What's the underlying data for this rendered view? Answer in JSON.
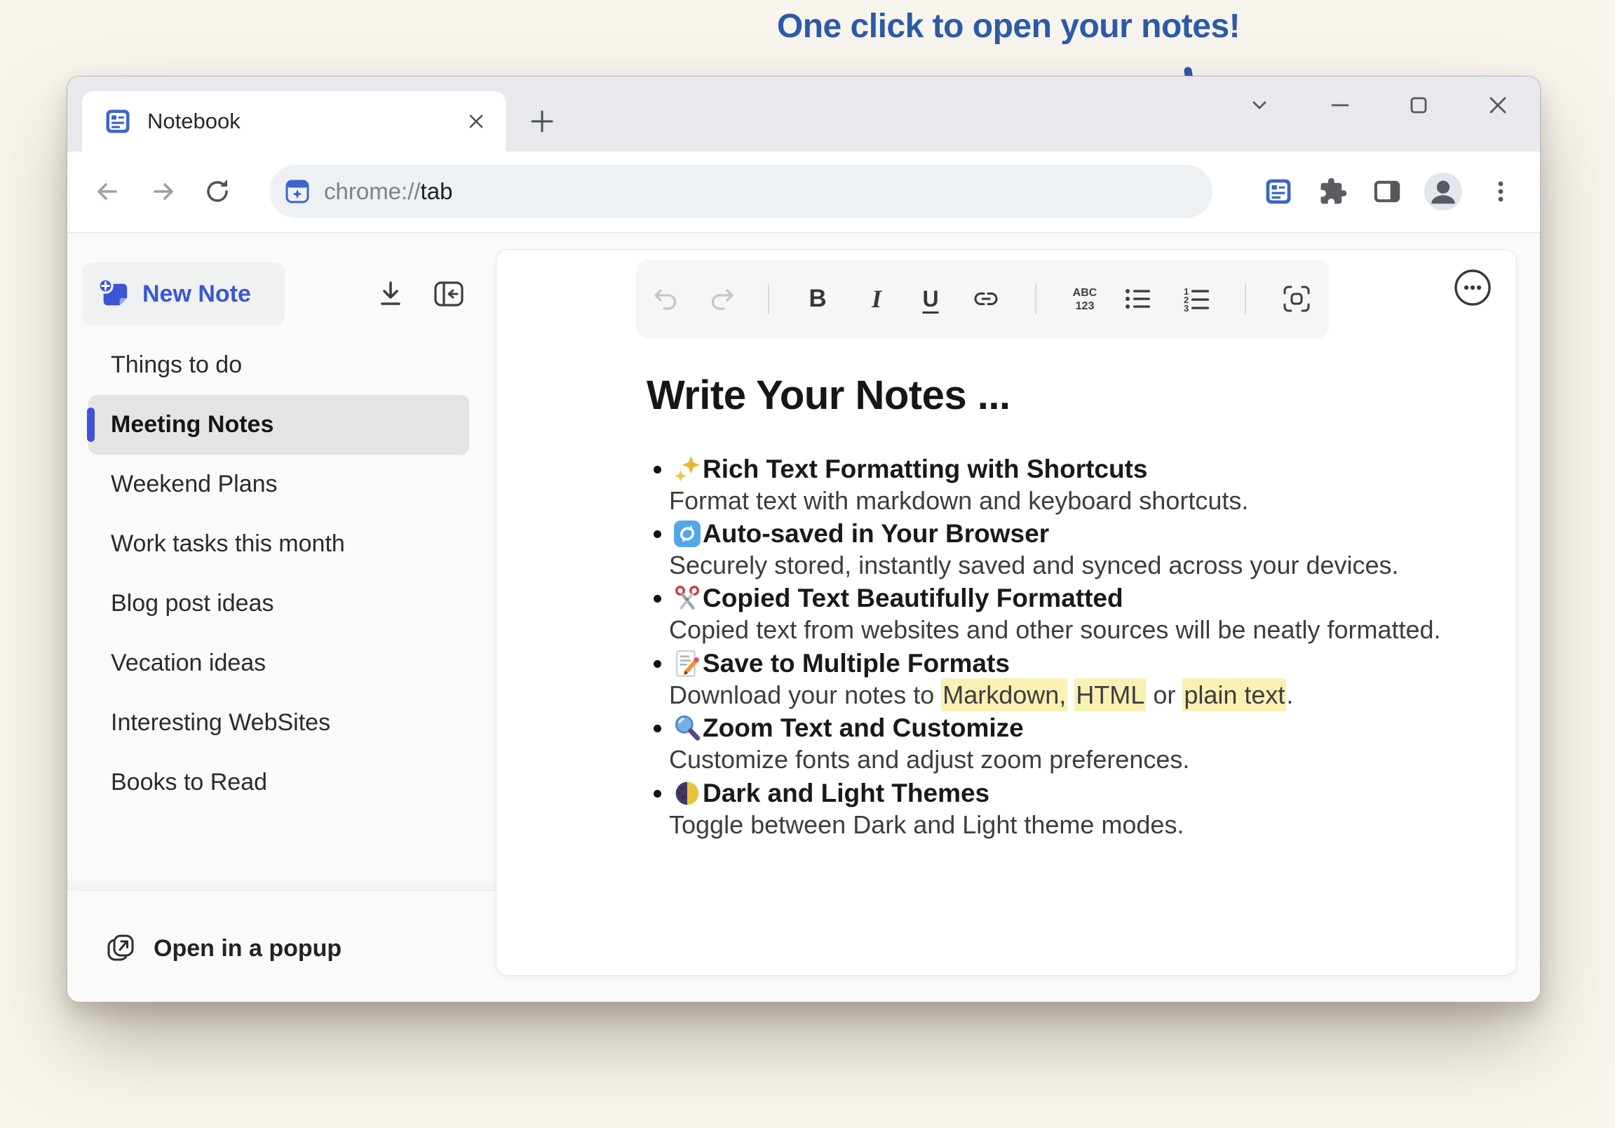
{
  "annotation": {
    "headline": "One click to open your notes!",
    "arrow_color": "#2b57a8"
  },
  "browser": {
    "tab": {
      "title": "Notebook",
      "favicon": "notebook-icon"
    },
    "window_controls": [
      "restore-down",
      "minimize",
      "maximize",
      "close"
    ],
    "address": {
      "protocol": "chrome://",
      "path": "tab",
      "site_icon": "notebook-sparkle-icon"
    },
    "toolbar_icons": [
      "notebook-extension",
      "extensions-puzzle",
      "side-panel",
      "profile-avatar",
      "menu-kebab"
    ]
  },
  "sidebar": {
    "new_note_label": "New Note",
    "actions": [
      "download",
      "collapse-panel"
    ],
    "items": [
      {
        "label": "Things to do",
        "selected": false
      },
      {
        "label": "Meeting Notes",
        "selected": true
      },
      {
        "label": "Weekend Plans",
        "selected": false
      },
      {
        "label": "Work tasks this month",
        "selected": false
      },
      {
        "label": "Blog post ideas",
        "selected": false
      },
      {
        "label": "Vecation ideas",
        "selected": false
      },
      {
        "label": "Interesting WebSites",
        "selected": false
      },
      {
        "label": "Books to Read",
        "selected": false
      }
    ],
    "open_popup_label": "Open in a popup"
  },
  "editor": {
    "toolbar": {
      "icons": [
        "undo",
        "redo",
        "bold",
        "italic",
        "underline",
        "link",
        "spellcheck-abc-123",
        "bulleted-list",
        "numbered-list",
        "focus-mode",
        "more-options"
      ],
      "spell_top": "ABC",
      "spell_bottom": "123"
    },
    "heading": "Write Your Notes ...",
    "highlight_color": "#f9f1b4",
    "accent_blue": "#3c55d6",
    "bullets": [
      {
        "icon": "sparkles-icon",
        "title": "Rich Text Formatting with Shortcuts",
        "desc": "Format text with markdown and keyboard shortcuts."
      },
      {
        "icon": "sync-icon",
        "title": "Auto-saved in Your Browser",
        "desc": "Securely stored, instantly saved and synced across your devices."
      },
      {
        "icon": "scissors-icon",
        "title": "Copied Text Beautifully Formatted",
        "desc": "Copied text from websites and other sources will be neatly formatted."
      },
      {
        "icon": "memo-icon",
        "title": "Save to Multiple Formats",
        "desc_segments": [
          {
            "text": "Download your notes to ",
            "hl": false
          },
          {
            "text": "Markdown,",
            "hl": true
          },
          {
            "text": " ",
            "hl": false
          },
          {
            "text": "HTML",
            "hl": true
          },
          {
            "text": " or ",
            "hl": false
          },
          {
            "text": "plain text",
            "hl": true
          },
          {
            "text": ".",
            "hl": false
          }
        ]
      },
      {
        "icon": "magnifier-icon",
        "title": "Zoom Text and Customize",
        "desc": "Customize fonts and adjust zoom preferences."
      },
      {
        "icon": "half-moon-icon",
        "title": "Dark and Light Themes",
        "desc": "Toggle between Dark and Light theme modes."
      }
    ]
  }
}
